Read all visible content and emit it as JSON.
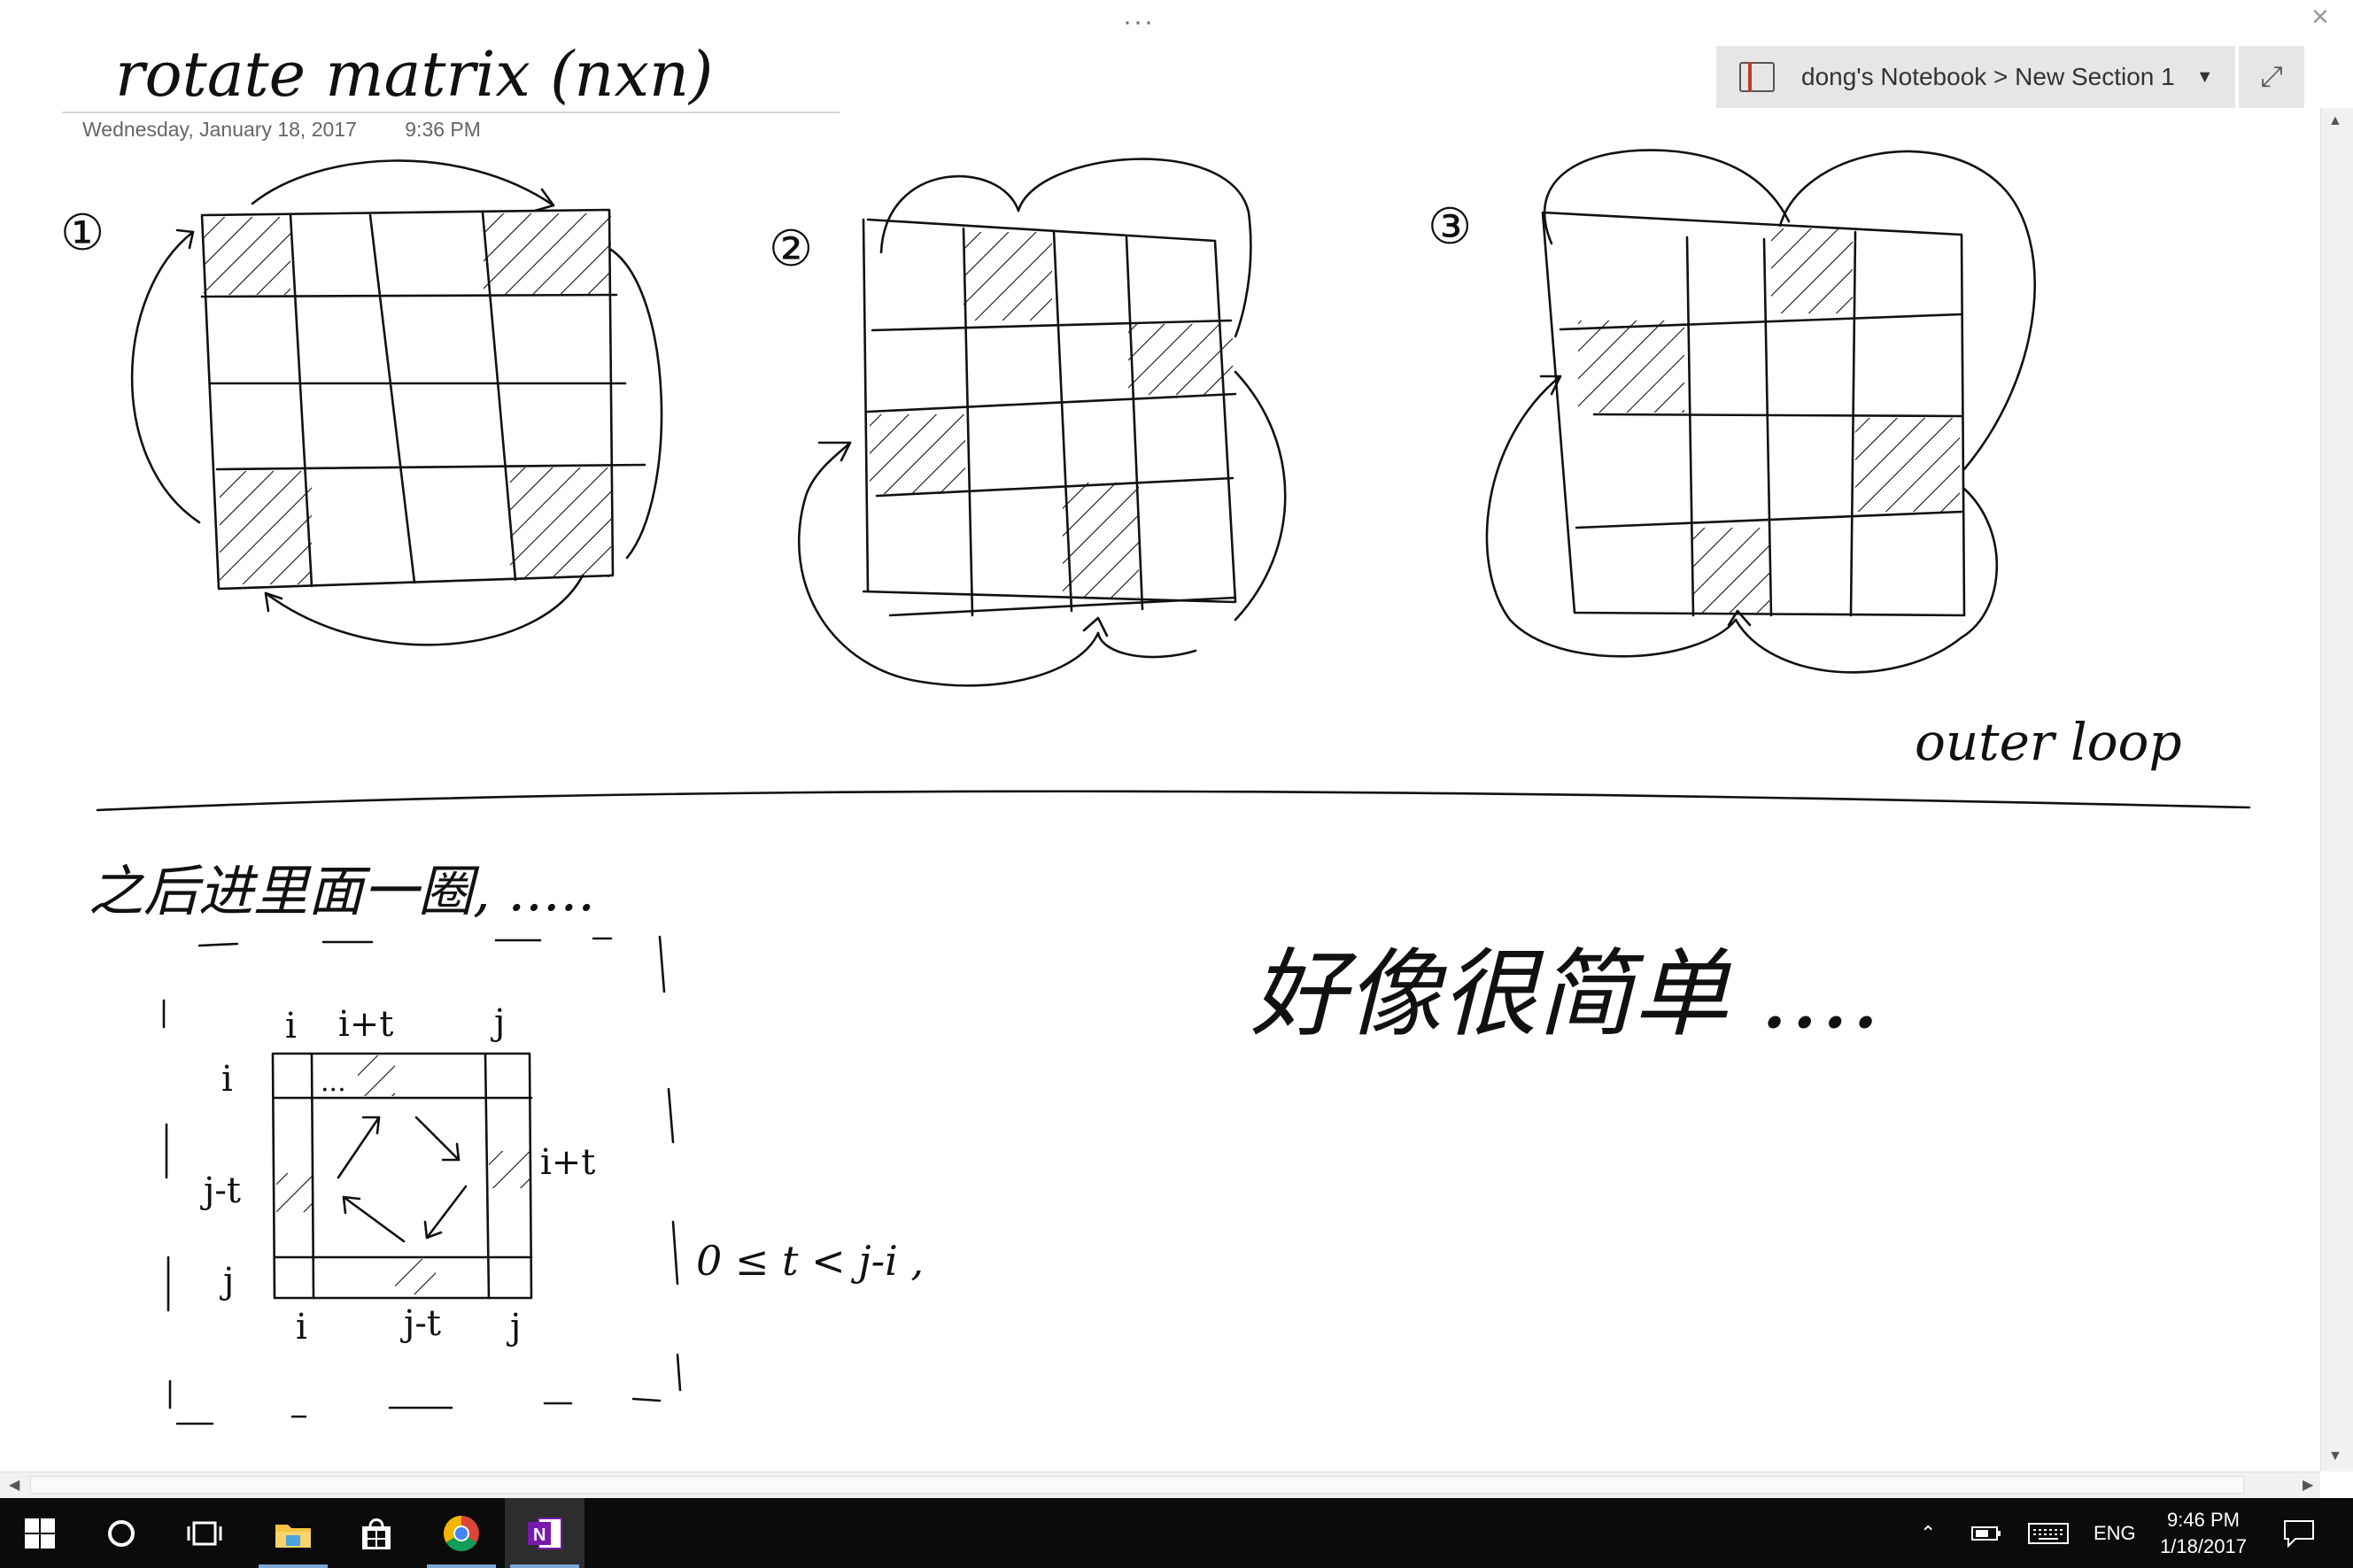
{
  "window": {
    "more_icon": "more-dots-icon",
    "close_icon": "close-icon"
  },
  "notebook_nav": {
    "label": "dong's Notebook > New Section 1",
    "expand_icon": "expand-icon"
  },
  "page": {
    "title": "rotate matrix (nxn)",
    "date": "Wednesday, January 18, 2017",
    "time": "9:36 PM"
  },
  "ink": {
    "step1": "①",
    "step2": "②",
    "step3": "③",
    "outer_loop": "outer loop",
    "inner_note": "之后进里面一圈, .....",
    "label_i_top": "i",
    "label_it_top": "i+t",
    "label_j_top": "j",
    "label_i_left": "i",
    "label_jt_left": "j-t",
    "label_j_left": "j",
    "label_it_right": "i+t",
    "label_i_bottom": "i",
    "label_jt_bottom": "j-t",
    "label_j_bottom": "j",
    "dots_inner": "...",
    "condition": "0 ≤ t < j-i ,",
    "easy_note": "好像很简单 ...."
  },
  "taskbar": {
    "apps": [
      {
        "name": "start-button",
        "icon": "windows-logo-icon"
      },
      {
        "name": "cortana-search",
        "icon": "cortana-ring-icon"
      },
      {
        "name": "task-view",
        "icon": "task-view-icon"
      },
      {
        "name": "file-explorer",
        "icon": "folder-icon"
      },
      {
        "name": "store",
        "icon": "store-bag-icon"
      },
      {
        "name": "chrome",
        "icon": "chrome-icon"
      },
      {
        "name": "onenote",
        "icon": "onenote-icon"
      }
    ],
    "language": "ENG",
    "clock_time": "9:46 PM",
    "clock_date": "1/18/2017"
  }
}
